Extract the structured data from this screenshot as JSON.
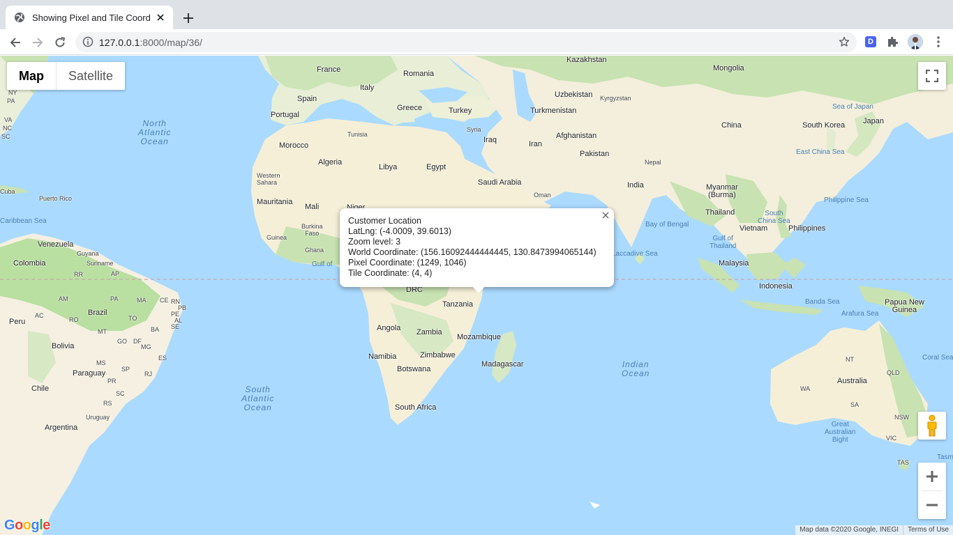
{
  "browser": {
    "tab_title": "Showing Pixel and Tile Coordin",
    "url_host": "127.0.0.1",
    "url_path": ":8000/map/36/",
    "extension_letter": "D"
  },
  "map": {
    "type_controls": [
      "Map",
      "Satellite"
    ],
    "active_type": "Map",
    "attribution": "Map data ©2020 Google, INEGI",
    "terms": "Terms of Use",
    "logo": "Google",
    "labels": {
      "countries": {
        "france": "France",
        "romania": "Romania",
        "kazakhstan": "Kazakhstan",
        "mongolia": "Mongolia",
        "spain": "Spain",
        "italy": "Italy",
        "greece": "Greece",
        "turkey": "Turkey",
        "uzbekistan": "Uzbekistan",
        "kyrgyzstan": "Kyrgyzstan",
        "turkmenistan": "Turkmenistan",
        "portugal": "Portugal",
        "syria": "Syria",
        "iraq": "Iraq",
        "iran": "Iran",
        "afghanistan": "Afghanistan",
        "china": "China",
        "south_korea": "South Korea",
        "japan": "Japan",
        "tunisia": "Tunisia",
        "morocco": "Morocco",
        "algeria": "Algeria",
        "libya": "Libya",
        "egypt": "Egypt",
        "pakistan": "Pakistan",
        "nepal": "Nepal",
        "western_sahara": "Western\nSahara",
        "saudi_arabia": "Saudi Arabia",
        "india": "India",
        "myanmar": "Myanmar\n(Burma)",
        "cuba": "Cuba",
        "puerto_rico": "Puerto Rico",
        "oman": "Oman",
        "mauritania": "Mauritania",
        "mali": "Mali",
        "niger": "Niger",
        "thailand": "Thailand",
        "philippines": "Philippines",
        "burkina_faso": "Burkina\nFaso",
        "vietnam": "Vietnam",
        "guinea": "Guinea",
        "venezuela": "Venezuela",
        "guyana": "Guyana",
        "suriname": "Suriname",
        "ghana": "Ghana",
        "colombia": "Colombia",
        "malaysia": "Malaysia",
        "drc": "DRC",
        "indonesia": "Indonesia",
        "tanzania": "Tanzania",
        "papua_new_guinea": "Papua New\nGuinea",
        "peru": "Peru",
        "brazil": "Brazil",
        "angola": "Angola",
        "zambia": "Zambia",
        "mozambique": "Mozambique",
        "bolivia": "Bolivia",
        "namibia": "Namibia",
        "zimbabwe": "Zimbabwe",
        "madagascar": "Madagascar",
        "paraguay": "Paraguay",
        "botswana": "Botswana",
        "australia": "Australia",
        "chile": "Chile",
        "south_africa": "South Africa",
        "uruguay": "Uruguay",
        "argentina": "Argentina"
      },
      "states": {
        "pa": "PA",
        "ny": "NY",
        "va": "VA",
        "nc": "NC",
        "sc": "SC",
        "ap": "AP",
        "rr": "RR",
        "am": "AM",
        "pa2": "PA",
        "ma": "MA",
        "ce": "CE",
        "rn": "RN",
        "pb": "PB",
        "pe": "PE",
        "ac": "AC",
        "ro": "RO",
        "to": "TO",
        "ba": "BA",
        "al": "AL",
        "se": "SE",
        "mt": "MT",
        "go": "GO",
        "df": "DF",
        "mg": "MG",
        "es": "ES",
        "ms": "MS",
        "sp": "SP",
        "rj": "RJ",
        "pr": "PR",
        "sc2": "SC",
        "rs": "RS",
        "nt": "NT",
        "qld": "QLD",
        "wa": "WA",
        "sa": "SA",
        "nsw": "NSW",
        "vic": "VIC",
        "tas": "TAS",
        "tasm": "Tasm"
      },
      "oceans": {
        "north_atlantic": "North\nAtlantic\nOcean",
        "south_atlantic": "South\nAtlantic\nOcean",
        "indian": "Indian\nOcean"
      },
      "seas": {
        "sea_of_japan": "Sea of Japan",
        "east_china_sea": "East China Sea",
        "philippine_sea": "Philippine Sea",
        "south_china_sea": "South\nChina Sea",
        "bay_of_bengal": "Bay of Bengal",
        "gulf_of_thailand": "Gulf of\nThailand",
        "laccadive_sea": "Laccadive Sea",
        "caribbean_sea": "Caribbean Sea",
        "gulf_of_guinea": "Gulf of",
        "banda_sea": "Banda Sea",
        "arafura_sea": "Arafura Sea",
        "coral_sea": "Coral Sea",
        "great_australian_bight": "Great\nAustralian\nBight"
      }
    }
  },
  "info_window": {
    "title": "Customer Location",
    "latlng": "LatLng: (-4.0009, 39.6013)",
    "zoom": "Zoom level: 3",
    "world": "World Coordinate: (156.16092444444445, 130.8473994065144)",
    "pixel": "Pixel Coordinate: (1249, 1046)",
    "tile": "Tile Coordinate: (4, 4)"
  },
  "colors": {
    "water": "#aadaff",
    "land": "#f5f0e1",
    "vegetation": "#c8e6b0",
    "desert": "#f6efd8",
    "ice": "#ffffff"
  }
}
